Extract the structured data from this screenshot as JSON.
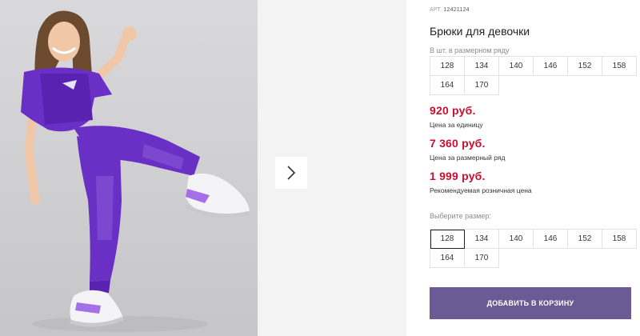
{
  "product": {
    "sku_label": "АРТ.",
    "sku_value": "12421124",
    "title": "Брюки для девочки"
  },
  "size_range": {
    "caption": "В шт. в размерном ряду",
    "sizes": [
      "128",
      "134",
      "140",
      "146",
      "152",
      "158",
      "164",
      "170"
    ]
  },
  "prices": [
    {
      "value": "920 руб.",
      "label": "Цена за единицу"
    },
    {
      "value": "7 360 руб.",
      "label": "Цена за размерный ряд"
    },
    {
      "value": "1 999 руб.",
      "label": "Рекомендуемая розничная цена"
    }
  ],
  "size_select": {
    "caption": "Выберите размер:",
    "sizes": [
      "128",
      "134",
      "140",
      "146",
      "152",
      "158",
      "164",
      "170"
    ],
    "selected": "128"
  },
  "cart_button_label": "ДОБАВИТЬ В КОРЗИНУ",
  "gallery": {
    "next_icon": "chevron-right-icon",
    "image": "product-photo"
  },
  "colors": {
    "price": "#c8102e",
    "button": "#6b5a94",
    "outfit": "#6a2fc4"
  }
}
